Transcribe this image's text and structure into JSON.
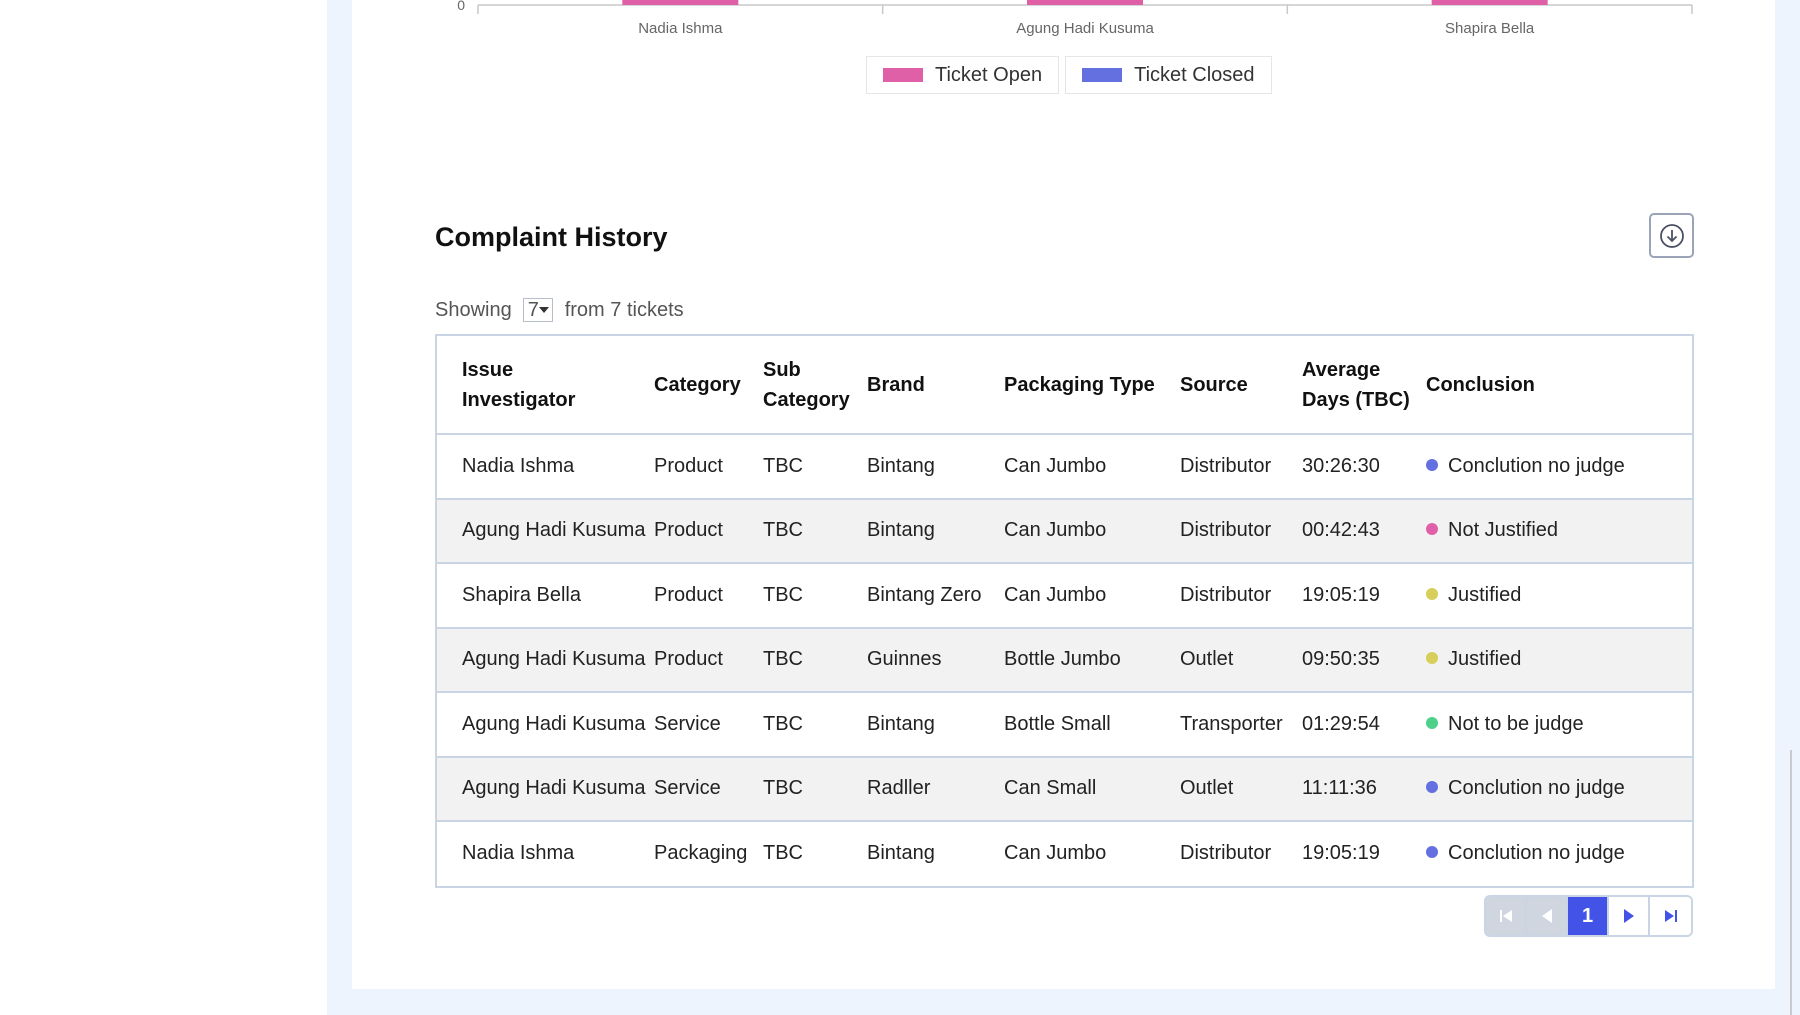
{
  "chart_data": {
    "type": "bar",
    "categories": [
      "Nadia Ishma",
      "Agung Hadi Kusuma",
      "Shapira Bella"
    ],
    "series": [
      {
        "name": "Ticket Open",
        "color": "#e060a8"
      },
      {
        "name": "Ticket Closed",
        "color": "#6470e0"
      }
    ],
    "y_tick_visible": "0"
  },
  "complaint_history": {
    "title": "Complaint History",
    "download_icon": "download-circle-icon",
    "showing_label": "Showing",
    "showing_value": "7",
    "showing_suffix": "from 7 tickets",
    "columns": [
      "Issue Investigator",
      "Category",
      "Sub Category",
      "Brand",
      "Packaging Type",
      "Source",
      "Average Days (TBC)",
      "Conclusion"
    ],
    "rows": [
      {
        "investigator": "Nadia Ishma",
        "category": "Product",
        "sub_category": "TBC",
        "brand": "Bintang",
        "packaging": "Can Jumbo",
        "source": "Distributor",
        "avg_days": "30:26:30",
        "conclusion": "Conclution no judge",
        "conclusion_color": "#6470e0"
      },
      {
        "investigator": "Agung Hadi Kusuma",
        "category": "Product",
        "sub_category": "TBC",
        "brand": "Bintang",
        "packaging": "Can Jumbo",
        "source": "Distributor",
        "avg_days": "00:42:43",
        "conclusion": "Not Justified",
        "conclusion_color": "#e060a8"
      },
      {
        "investigator": "Shapira Bella",
        "category": "Product",
        "sub_category": "TBC",
        "brand": "Bintang Zero",
        "packaging": "Can Jumbo",
        "source": "Distributor",
        "avg_days": "19:05:19",
        "conclusion": "Justified",
        "conclusion_color": "#d8cf5a"
      },
      {
        "investigator": "Agung Hadi Kusuma",
        "category": "Product",
        "sub_category": "TBC",
        "brand": "Guinnes",
        "packaging": "Bottle Jumbo",
        "source": "Outlet",
        "avg_days": "09:50:35",
        "conclusion": "Justified",
        "conclusion_color": "#d8cf5a"
      },
      {
        "investigator": "Agung Hadi Kusuma",
        "category": "Service",
        "sub_category": "TBC",
        "brand": "Bintang",
        "packaging": "Bottle Small",
        "source": "Transporter",
        "avg_days": "01:29:54",
        "conclusion": "Not to be judge",
        "conclusion_color": "#4fd08a"
      },
      {
        "investigator": "Agung Hadi Kusuma",
        "category": "Service",
        "sub_category": "TBC",
        "brand": "Radller",
        "packaging": "Can Small",
        "source": "Outlet",
        "avg_days": "11:11:36",
        "conclusion": "Conclution no judge",
        "conclusion_color": "#6470e0"
      },
      {
        "investigator": "Nadia Ishma",
        "category": "Packaging",
        "sub_category": "TBC",
        "brand": "Bintang",
        "packaging": "Can Jumbo",
        "source": "Distributor",
        "avg_days": "19:05:19",
        "conclusion": "Conclution no judge",
        "conclusion_color": "#6470e0"
      }
    ]
  },
  "pagination": {
    "current_page": "1",
    "first_icon": "first-page-icon",
    "prev_icon": "previous-page-icon",
    "next_icon": "next-page-icon",
    "last_icon": "last-page-icon"
  }
}
